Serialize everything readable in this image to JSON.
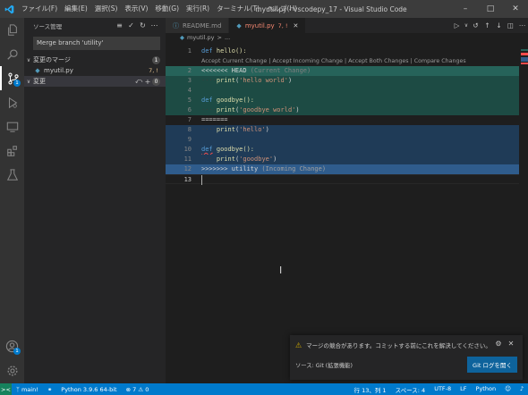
{
  "titlebar": {
    "menu": [
      "ファイル(F)",
      "編集(E)",
      "選択(S)",
      "表示(V)",
      "移動(G)",
      "実行(R)",
      "ターミナル(T)",
      "ヘルプ(H)"
    ],
    "title": "myutil.py - vscodepy_17 - Visual Studio Code"
  },
  "activitybar": {
    "scm_badge": "1"
  },
  "sidebar": {
    "title": "ソース管理",
    "commit_message": "Merge branch 'utility'",
    "merge_changes": {
      "label": "変更のマージ",
      "count": "1"
    },
    "file": {
      "name": "myutil.py",
      "status": "7, !"
    },
    "changes": {
      "label": "変更",
      "count": "0"
    }
  },
  "editor": {
    "tabs": [
      {
        "label": "README.md"
      },
      {
        "label": "myutil.py",
        "status": "7, !"
      }
    ],
    "breadcrumb": {
      "file": "myutil.py",
      "more": "..."
    },
    "codelens": "Accept Current Change | Accept Incoming Change | Accept Both Changes | Compare Changes",
    "lines": {
      "l1": {
        "n": "1",
        "kw": "def",
        "rest": " hello():"
      },
      "l2": {
        "n": "2",
        "head": "<<<<<<< HEAD",
        "label": " (Current Change)"
      },
      "l3": {
        "n": "3",
        "ws": "····",
        "fn": "print",
        "p1": "(",
        "str": "'hello world'",
        "p2": ")"
      },
      "l4": {
        "n": "4"
      },
      "l5": {
        "n": "5",
        "kw": "def",
        "rest": " goodbye():"
      },
      "l6": {
        "n": "6",
        "ws": "····",
        "fn": "print",
        "p1": "(",
        "str": "'goodbye world'",
        "p2": ")"
      },
      "l7": {
        "n": "7",
        "text": "======="
      },
      "l8": {
        "n": "8",
        "ws": "····",
        "fn": "print",
        "p1": "(",
        "str": "'hello'",
        "p2": ")"
      },
      "l9": {
        "n": "9"
      },
      "l10": {
        "n": "10",
        "kw": "def",
        "rest": " goodbye():"
      },
      "l11": {
        "n": "11",
        "ws": "····",
        "fn": "print",
        "p1": "(",
        "str": "'goodbye'",
        "p2": ")"
      },
      "l12": {
        "n": "12",
        "head": ">>>>>>> utility",
        "label": " (Incoming Change)"
      },
      "l13": {
        "n": "13"
      }
    }
  },
  "notification": {
    "message": "マージの競合があります。コミットする前にこれを解決してください。",
    "source": "ソース: Git (拡張機能)",
    "button": "Git ログを開く"
  },
  "statusbar": {
    "branch": "main!",
    "python": "Python 3.9.6 64-bit",
    "problems": "7",
    "warnings": "0",
    "position": "行 13、列 1",
    "spaces": "スペース: 4",
    "encoding": "UTF-8",
    "eol": "LF",
    "language": "Python"
  },
  "colors": {
    "accent": "#007acc",
    "current_change": "#26635a",
    "incoming_change": "#2f5c8c",
    "warning": "#cca700"
  }
}
